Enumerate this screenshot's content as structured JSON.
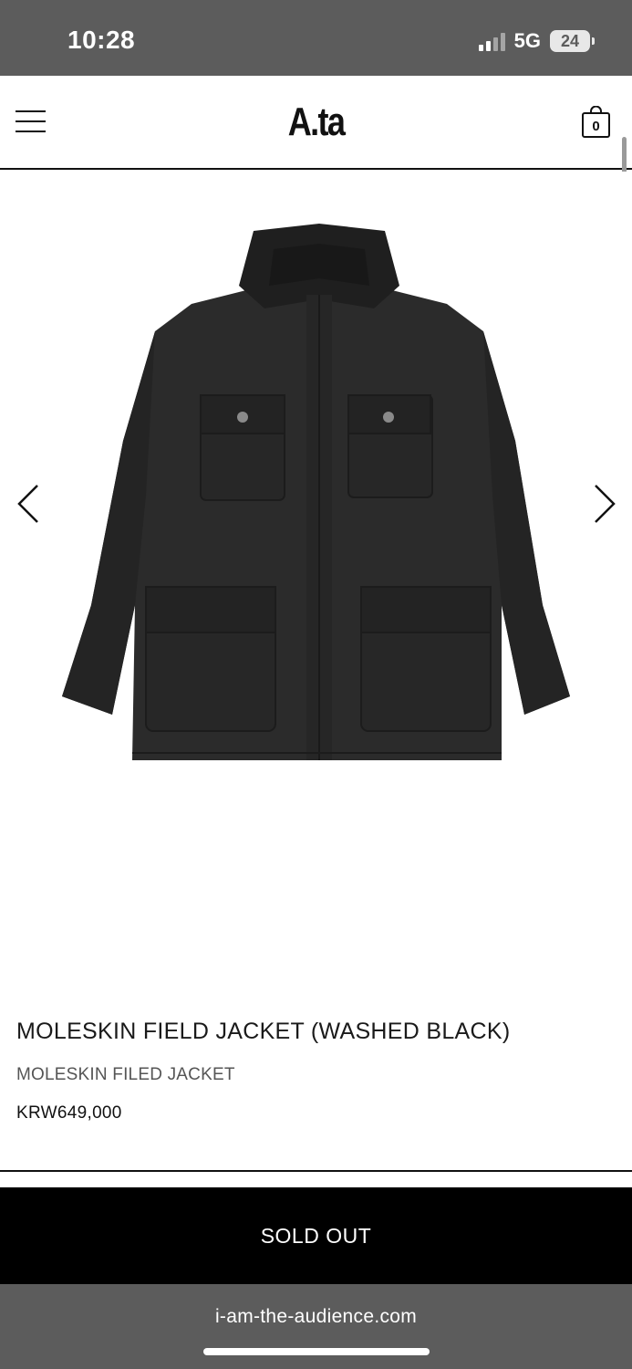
{
  "status_bar": {
    "time": "10:28",
    "network": "5G",
    "battery": "24"
  },
  "header": {
    "logo": "A.ta",
    "cart_count": "0",
    "menu_icon": "hamburger-menu-icon",
    "cart_icon": "shopping-bag-icon"
  },
  "gallery": {
    "prev_icon": "chevron-left-icon",
    "next_icon": "chevron-right-icon",
    "image_subject": "black field jacket"
  },
  "product": {
    "title": "MOLESKIN FIELD JACKET (WASHED BLACK)",
    "subtitle": "MOLESKIN FILED JACKET",
    "price": "KRW649,000"
  },
  "actions": {
    "sold_out_label": "SOLD OUT"
  },
  "browser": {
    "url": "i-am-the-audience.com"
  },
  "colors": {
    "status_bar_bg": "#5c5c5c",
    "button_bg": "#000000",
    "text": "#111111"
  }
}
